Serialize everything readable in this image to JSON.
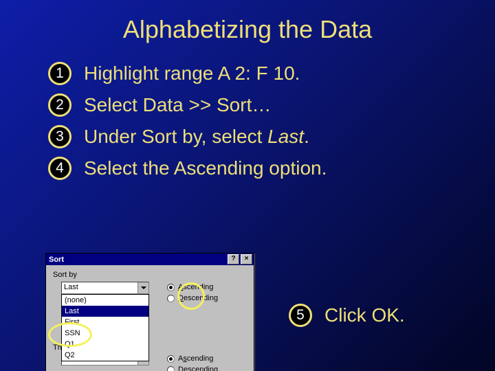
{
  "title": "Alphabetizing the Data",
  "steps": [
    {
      "n": "1",
      "text": "Highlight range A 2: F 10."
    },
    {
      "n": "2",
      "text": "Select Data >> Sort…"
    },
    {
      "n": "3",
      "prefix": "Under Sort by, select ",
      "em": "Last",
      "suffix": "."
    },
    {
      "n": "4",
      "text": "Select the Ascending option."
    }
  ],
  "step5": {
    "n": "5",
    "text": "Click OK."
  },
  "dialog": {
    "title": "Sort",
    "help_btn": "?",
    "close_btn": "×",
    "group_sortby": "Sort by",
    "combo1_value": "Last",
    "dropdown_items": [
      "(none)",
      "Last",
      "First",
      "SSN",
      "Q1",
      "Q2"
    ],
    "dropdown_selected_index": 1,
    "radio_asc": "Ascending",
    "radio_asc_accel": "A",
    "radio_desc": "Descending",
    "radio_desc_accel": "D",
    "group_thenby": "Then by",
    "combo2_value": "",
    "radio2_asc": "Ascending",
    "radio2_asc_accel": "s",
    "radio2_desc": "Descending",
    "radio2_desc_accel": "e"
  }
}
